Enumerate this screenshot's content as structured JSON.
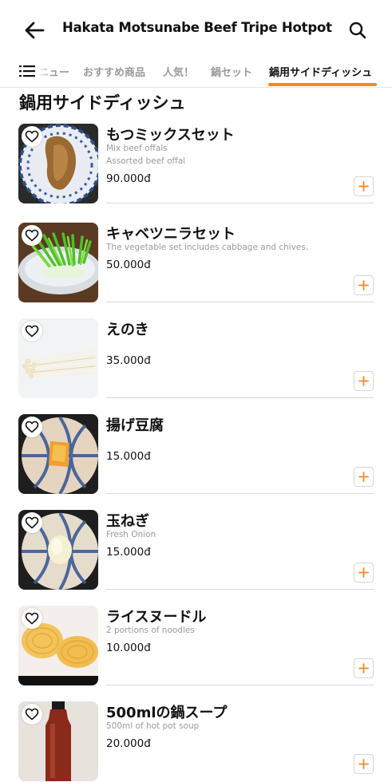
{
  "header": {
    "title": "Hakata Motsunabe Beef Tripe Hotpot",
    "back_icon": "arrow-left-icon",
    "search_icon": "search-icon"
  },
  "tabs": {
    "menu_icon": "list-menu-icon",
    "items": [
      {
        "label": "ニュー",
        "active": false
      },
      {
        "label": "おすすめ商品",
        "active": false
      },
      {
        "label": "人気！",
        "active": false
      },
      {
        "label": "鍋セット",
        "active": false
      },
      {
        "label": "鍋用サイドディッシュ",
        "active": true
      }
    ],
    "accent_color": "#f08a24"
  },
  "section": {
    "title": "鍋用サイドディッシュ"
  },
  "items": [
    {
      "name": "もつミックスセット",
      "desc1": "Mix beef offals",
      "desc2": "Assorted beef offal",
      "price": "90.000đ"
    },
    {
      "name": "キャベツニラセット",
      "desc1": "The vegetable set includes cabbage and chives.",
      "desc2": "",
      "price": "50.000đ"
    },
    {
      "name": "えのき",
      "desc1": "",
      "desc2": "",
      "price": "35.000đ"
    },
    {
      "name": "揚げ豆腐",
      "desc1": "",
      "desc2": "",
      "price": "15.000đ"
    },
    {
      "name": "玉ねぎ",
      "desc1": "Fresh Onion",
      "desc2": "",
      "price": "15.000đ"
    },
    {
      "name": "ライスヌードル",
      "desc1": "2 portions of noodles",
      "desc2": "",
      "price": "10.000đ"
    },
    {
      "name": "500mlの鍋スープ",
      "desc1": "500ml of hot pot soup",
      "desc2": "",
      "price": "20.000đ"
    }
  ],
  "icons": {
    "favorite": "heart-outline-icon",
    "add": "plus-icon"
  }
}
